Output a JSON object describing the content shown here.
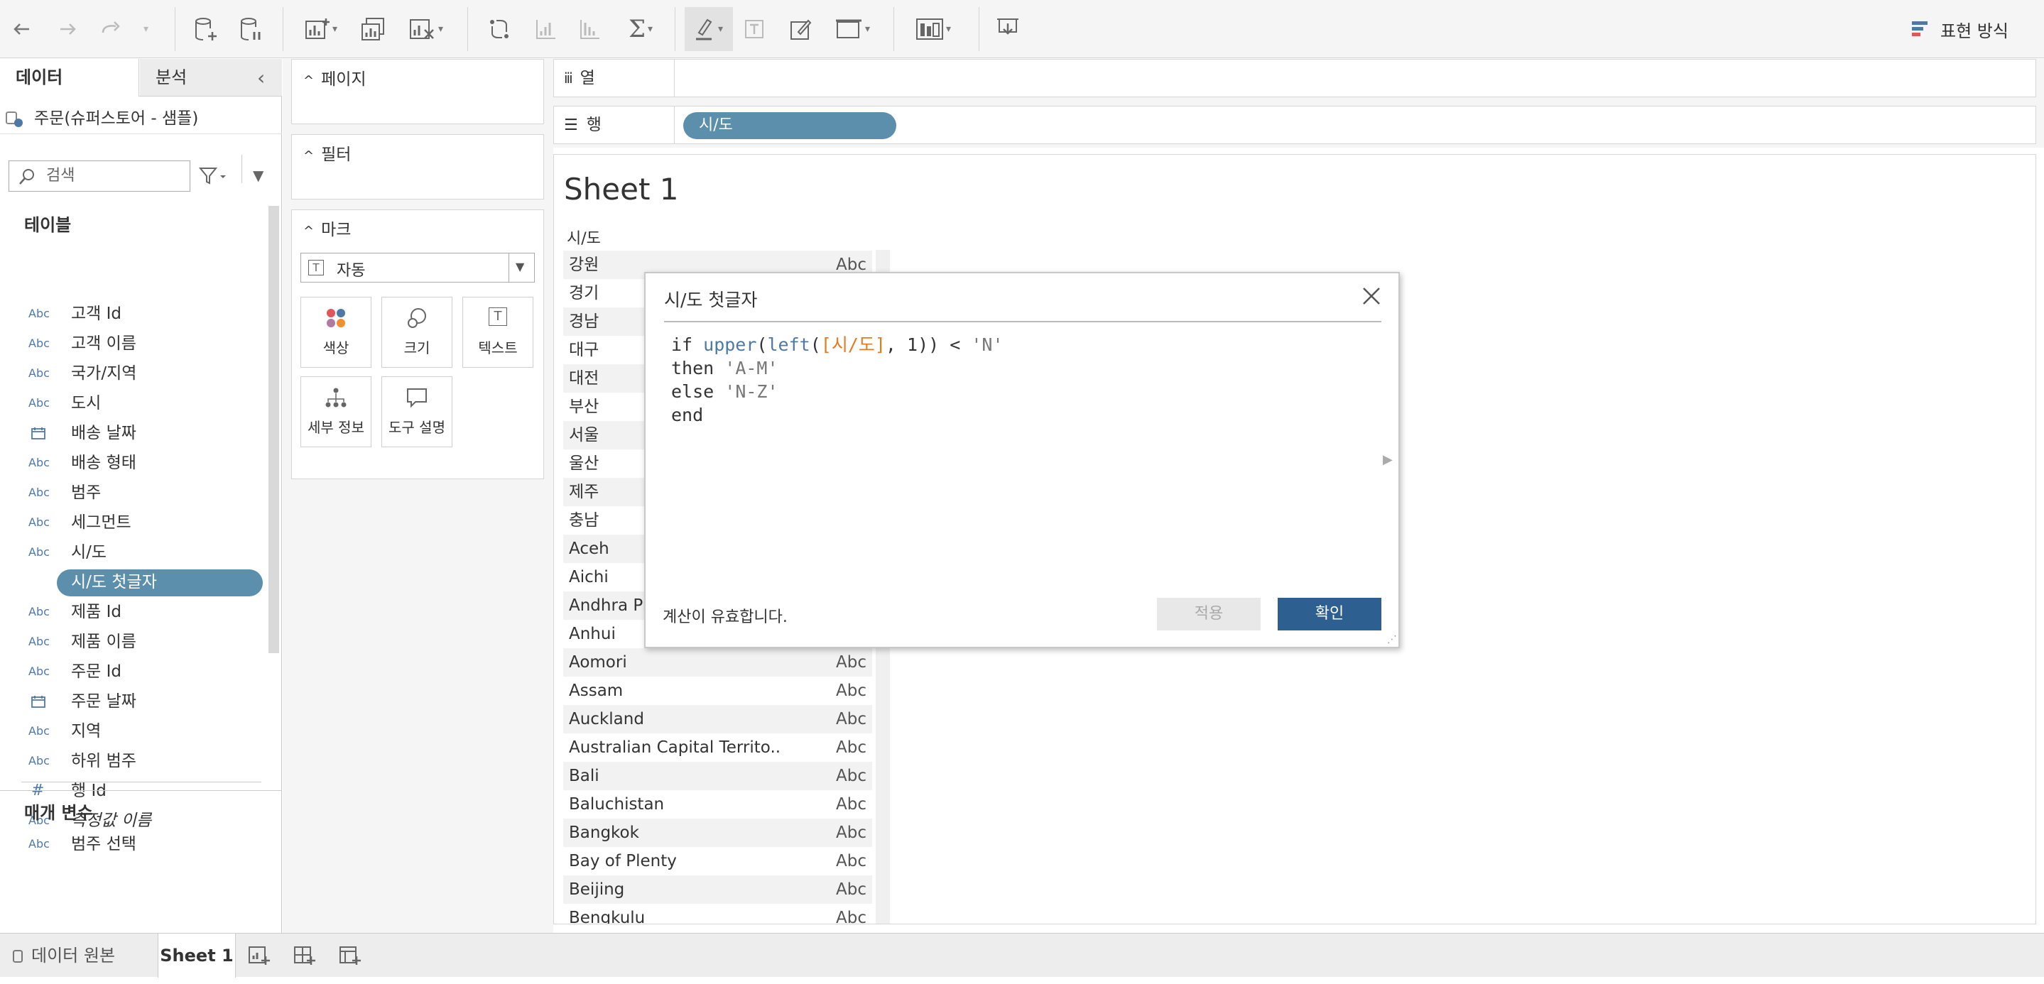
{
  "toolbar": {
    "icons": [
      "back-icon",
      "forward-icon",
      "redo-icon",
      "redo-menu-icon",
      "new-datasource-icon",
      "pause-update-icon",
      "new-sheet-icon",
      "duplicate-sheet-icon",
      "clear-sheet-icon",
      "swap-icon",
      "sort-asc-icon",
      "sort-desc-icon",
      "totals-icon",
      "highlight-icon",
      "labels-icon",
      "format-workbook-icon",
      "fit-icon",
      "show-cards-icon",
      "presentation-icon"
    ],
    "show_me_label": "표현 방식"
  },
  "left_pane": {
    "tabs": {
      "data": "데이터",
      "analytics": "분석"
    },
    "datasource": "주문(슈퍼스토어 - 샘플)",
    "search_placeholder": "검색",
    "tables_header": "테이블",
    "fields": [
      {
        "type": "Abc",
        "name": "고객 Id"
      },
      {
        "type": "Abc",
        "name": "고객 이름"
      },
      {
        "type": "Abc",
        "name": "국가/지역"
      },
      {
        "type": "Abc",
        "name": "도시"
      },
      {
        "type": "date",
        "name": "배송 날짜"
      },
      {
        "type": "Abc",
        "name": "배송 형태"
      },
      {
        "type": "Abc",
        "name": "범주"
      },
      {
        "type": "Abc",
        "name": "세그먼트"
      },
      {
        "type": "Abc",
        "name": "시/도"
      },
      {
        "type": "=Abc",
        "name": "시/도 첫글자"
      },
      {
        "type": "Abc",
        "name": "제품 Id"
      },
      {
        "type": "Abc",
        "name": "제품 이름"
      },
      {
        "type": "Abc",
        "name": "주문 Id"
      },
      {
        "type": "date",
        "name": "주문 날짜"
      },
      {
        "type": "Abc",
        "name": "지역"
      },
      {
        "type": "Abc",
        "name": "하위 범주"
      },
      {
        "type": "#",
        "name": "행 Id"
      },
      {
        "type": "Abc",
        "name": "측정값 이름"
      }
    ],
    "params_header": "매개 변수",
    "params": [
      {
        "type": "Abc",
        "name": "범주 선택"
      }
    ]
  },
  "cards": {
    "pages": "페이지",
    "filters": "필터",
    "marks": "마크",
    "mark_type": "자동",
    "mark_buttons": {
      "color": "색상",
      "size": "크기",
      "text": "텍스트",
      "detail": "세부 정보",
      "tooltip": "도구 설명"
    }
  },
  "shelves": {
    "columns": "열",
    "rows": "행",
    "row_pill": "시/도"
  },
  "view": {
    "title": "Sheet 1",
    "col_header": "시/도",
    "abc": "Abc",
    "rows": [
      "강원",
      "경기",
      "경남",
      "대구",
      "대전",
      "부산",
      "서울",
      "울산",
      "제주",
      "충남",
      "Aceh",
      "Aichi",
      "Andhra Pr",
      "Anhui",
      "Aomori",
      "Assam",
      "Auckland",
      "Australian Capital Territo..",
      "Bali",
      "Baluchistan",
      "Bangkok",
      "Bay of Plenty",
      "Beijing",
      "Bengkulu"
    ]
  },
  "dialog": {
    "title": "시/도 첫글자",
    "code": {
      "l1_kw": "if ",
      "l1_fn1": "upper",
      "l1_p1": "(",
      "l1_fn2": "left",
      "l1_p2": "(",
      "l1_field": "[시/도]",
      "l1_rest": ", 1)) < ",
      "l1_str": "'N'",
      "l2_kw": "then ",
      "l2_str": "'A-M'",
      "l3_kw": "else ",
      "l3_str": "'N-Z'",
      "l4_kw": "end"
    },
    "status": "계산이 유효합니다.",
    "apply": "적용",
    "ok": "확인"
  },
  "bottom": {
    "datasource_tab": "데이터 원본",
    "sheet_tab": "Sheet 1"
  },
  "colors": {
    "accent": "#5b8fab",
    "ok_button": "#2d5f91",
    "field_icon": "#4e79a7",
    "calc_field": "#e37b1e"
  }
}
